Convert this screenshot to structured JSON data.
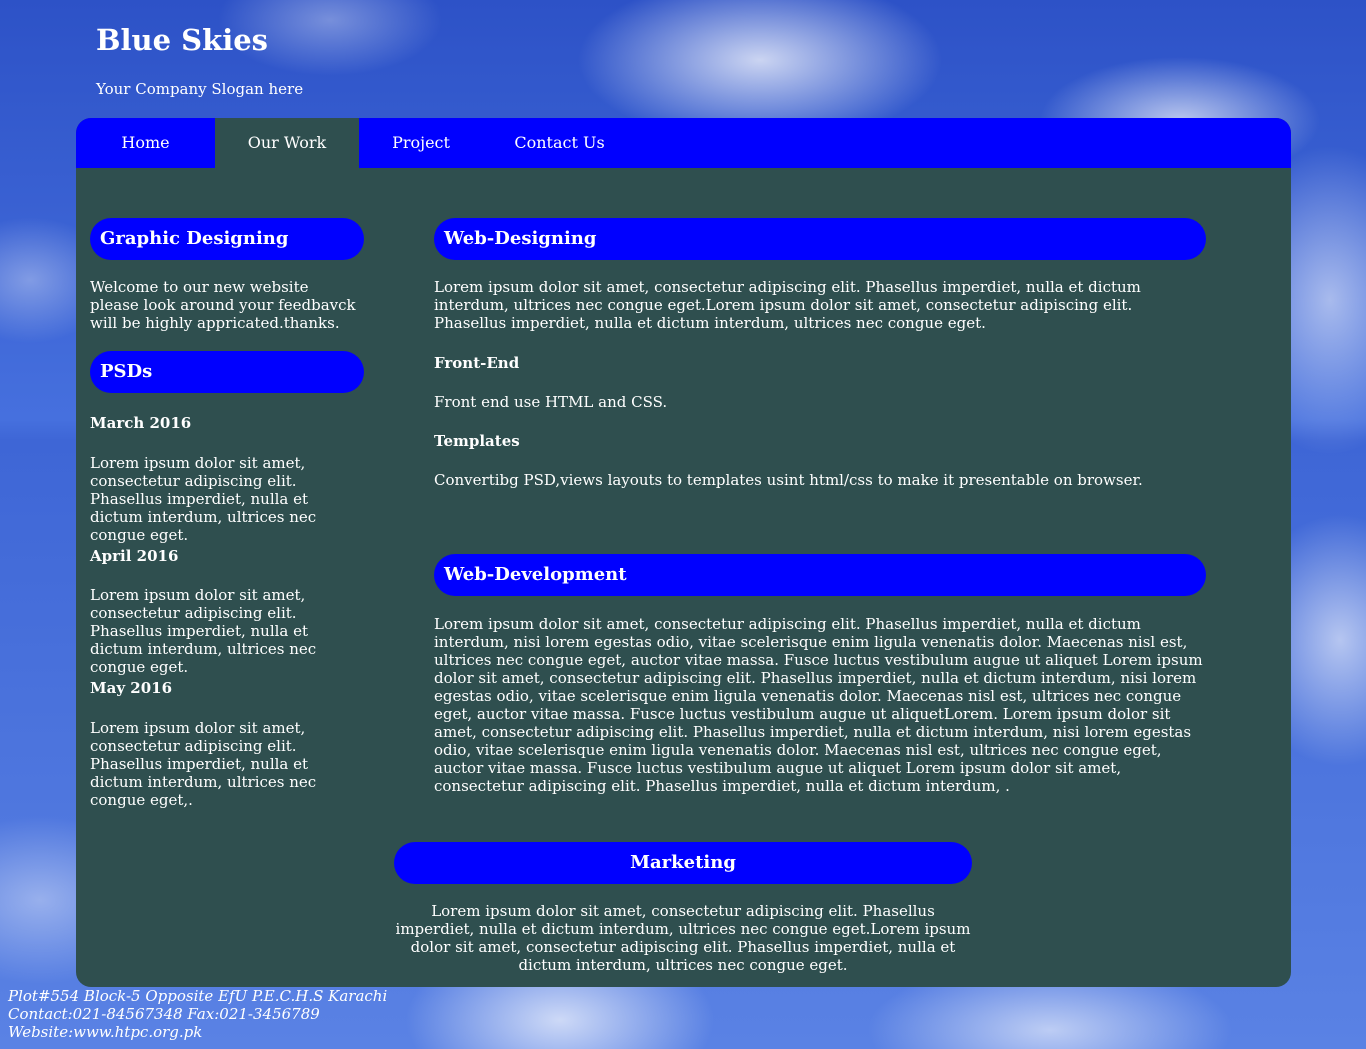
{
  "header": {
    "title": "Blue Skies",
    "slogan": "Your Company Slogan here"
  },
  "nav": {
    "items": [
      "Home",
      "Our Work",
      "Project",
      "Contact Us"
    ],
    "active": "Our Work"
  },
  "sidebar": {
    "graphic": {
      "heading": "Graphic Designing",
      "text": "Welcome to our new website please look around your feedbavck will be highly appricated.thanks."
    },
    "psds": {
      "heading": "PSDs",
      "entries": [
        {
          "date": "March 2016",
          "text": "Lorem ipsum dolor sit amet, consectetur adipiscing elit. Phasellus imperdiet, nulla et dictum interdum, ultrices nec congue eget."
        },
        {
          "date": "April 2016",
          "text": "Lorem ipsum dolor sit amet, consectetur adipiscing elit. Phasellus imperdiet, nulla et dictum interdum, ultrices nec congue eget."
        },
        {
          "date": "May 2016",
          "text": "Lorem ipsum dolor sit amet, consectetur adipiscing elit. Phasellus imperdiet, nulla et dictum interdum, ultrices nec congue eget,."
        }
      ]
    }
  },
  "main": {
    "web_designing": {
      "heading": "Web-Designing",
      "intro": "Lorem ipsum dolor sit amet, consectetur adipiscing elit. Phasellus imperdiet, nulla et dictum interdum, ultrices nec congue eget.Lorem ipsum dolor sit amet, consectetur adipiscing elit. Phasellus imperdiet, nulla et dictum interdum, ultrices nec congue eget.",
      "frontend_heading": "Front-End",
      "frontend_text": "Front end use HTML and CSS.",
      "templates_heading": "Templates",
      "templates_text": "Convertibg PSD,views layouts to templates usint html/css to make it presentable on browser."
    },
    "web_development": {
      "heading": "Web-Development",
      "text": "Lorem ipsum dolor sit amet, consectetur adipiscing elit. Phasellus imperdiet, nulla et dictum interdum, nisi lorem egestas odio, vitae scelerisque enim ligula venenatis dolor. Maecenas nisl est, ultrices nec congue eget, auctor vitae massa. Fusce luctus vestibulum augue ut aliquet Lorem ipsum dolor sit amet, consectetur adipiscing elit. Phasellus imperdiet, nulla et dictum interdum, nisi lorem egestas odio, vitae scelerisque enim ligula venenatis dolor. Maecenas nisl est, ultrices nec congue eget, auctor vitae massa. Fusce luctus vestibulum augue ut aliquetLorem. Lorem ipsum dolor sit amet, consectetur adipiscing elit. Phasellus imperdiet, nulla et dictum interdum, nisi lorem egestas odio, vitae scelerisque enim ligula venenatis dolor. Maecenas nisl est, ultrices nec congue eget, auctor vitae massa. Fusce luctus vestibulum augue ut aliquet Lorem ipsum dolor sit amet, consectetur adipiscing elit. Phasellus imperdiet, nulla et dictum interdum, ."
    },
    "marketing": {
      "heading": "Marketing",
      "text": "Lorem ipsum dolor sit amet, consectetur adipiscing elit. Phasellus imperdiet, nulla et dictum interdum, ultrices nec congue eget.Lorem ipsum dolor sit amet, consectetur adipiscing elit. Phasellus imperdiet, nulla et dictum interdum, ultrices nec congue eget."
    }
  },
  "footer": {
    "address": "Plot#554 Block-5 Opposite EfU P.E.C.H.S Karachi",
    "contact": "Contact:021-84567348 Fax:021-3456789",
    "website": "Website:www.htpc.org.pk"
  },
  "colors": {
    "nav_bg": "#0000ff",
    "content_bg": "#2f4f4f",
    "text": "#ffffff"
  }
}
